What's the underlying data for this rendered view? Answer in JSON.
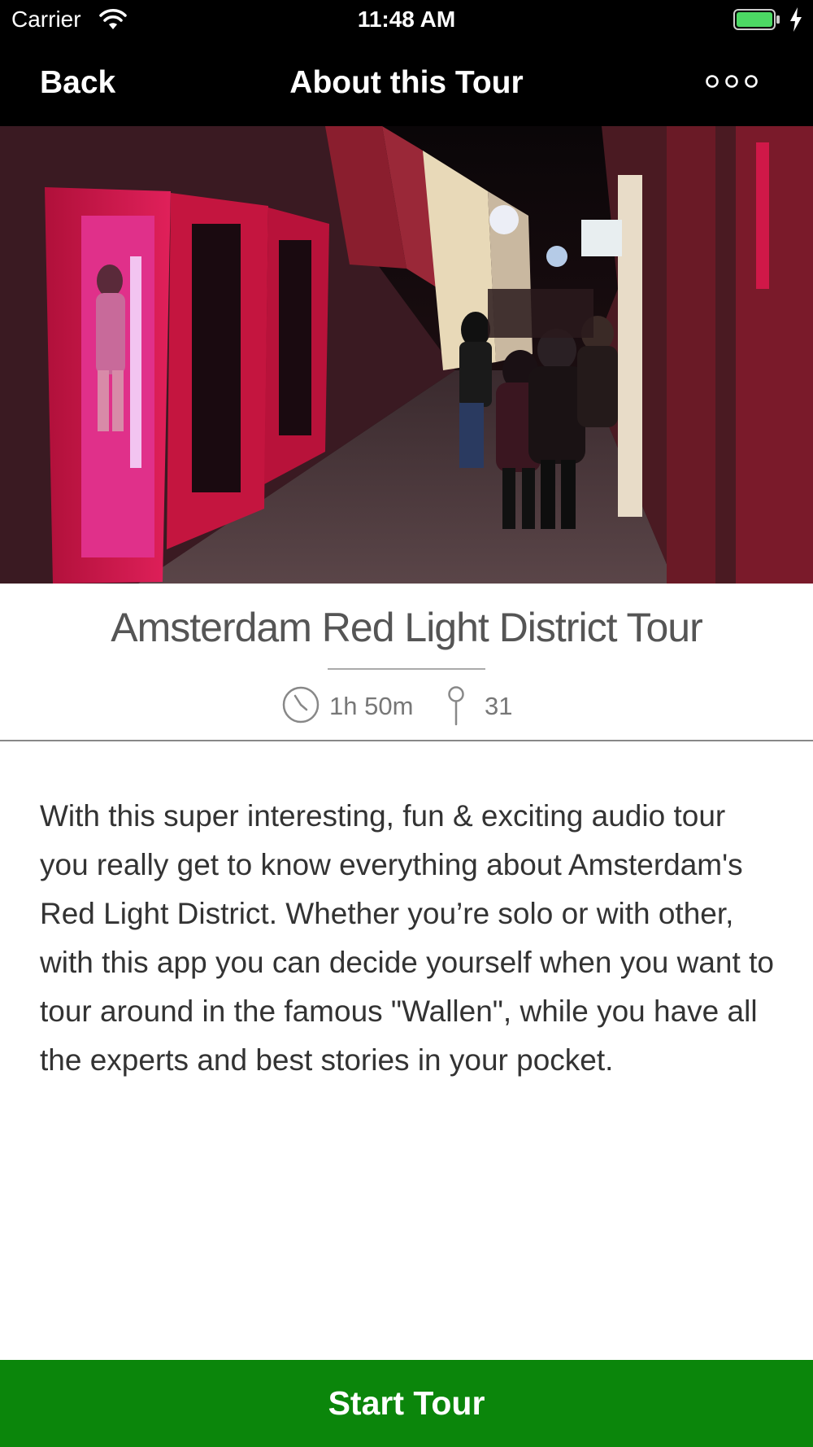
{
  "status_bar": {
    "carrier": "Carrier",
    "time": "11:48 AM",
    "icons": [
      "wifi-icon",
      "battery-icon",
      "charging-bolt-icon"
    ],
    "battery_color": "#4cd964"
  },
  "nav": {
    "back_label": "Back",
    "title": "About this Tour",
    "more_icon": "more-options-icon"
  },
  "hero": {
    "icon": "hero-photo"
  },
  "tour": {
    "title": "Amsterdam Red Light District Tour",
    "duration": "1h 50m",
    "stops": "31",
    "description": "With this super interesting, fun & exciting audio tour you really get to know everything about Amsterdam's Red Light District. Whether you’re solo or with other, with this app you can decide yourself when you want to tour around in the famous \"Wallen\", while you have all the experts and best stories in your pocket."
  },
  "actions": {
    "start_label": "Start Tour"
  },
  "colors": {
    "start_button": "#0b860b",
    "nav_background": "#000000",
    "text_dark": "#333333",
    "text_muted": "#777777"
  }
}
